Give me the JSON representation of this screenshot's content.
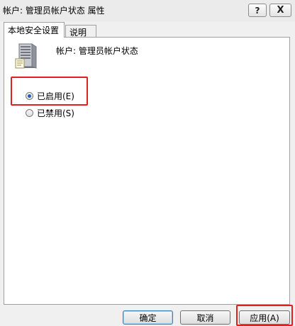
{
  "window": {
    "title": "帐户: 管理员帐户状态 属性",
    "help_label": "?",
    "close_label": "X"
  },
  "tabs": [
    {
      "label": "本地安全设置",
      "active": true
    },
    {
      "label": "说明",
      "active": false
    }
  ],
  "policy": {
    "icon": "server-icon",
    "name": "帐户: 管理员帐户状态"
  },
  "options": [
    {
      "label": "已启用(E)",
      "checked": true
    },
    {
      "label": "已禁用(S)",
      "checked": false
    }
  ],
  "buttons": {
    "ok": "确定",
    "cancel": "取消",
    "apply": "应用(A)"
  },
  "colors": {
    "highlight": "#e02020",
    "radio_selected": "#2a5bb0"
  }
}
